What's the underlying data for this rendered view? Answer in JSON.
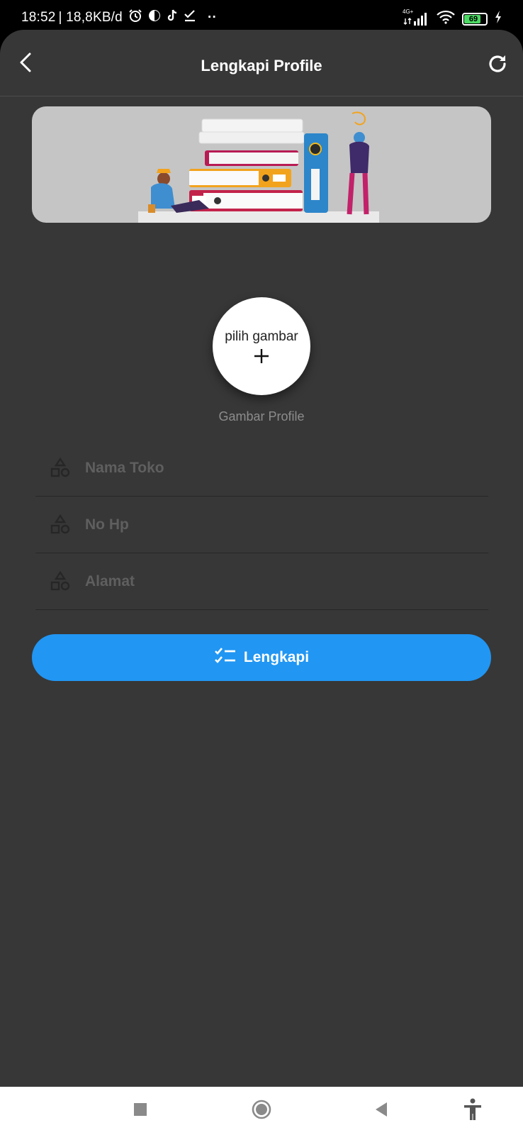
{
  "status_bar": {
    "time": "18:52",
    "net_speed": "| 18,8KB/d",
    "dots": "··",
    "signal_label": "4G+",
    "battery": "69"
  },
  "header": {
    "title": "Lengkapi Profile",
    "back_icon": "chevron-left-icon",
    "refresh_icon": "refresh-icon"
  },
  "banner": {
    "image": "people-with-stacked-books-illustration"
  },
  "avatar": {
    "button_label": "pilih gambar",
    "caption": "Gambar Profile"
  },
  "form": {
    "fields": [
      {
        "placeholder": "Nama Toko",
        "value": "",
        "icon": "shapes-icon"
      },
      {
        "placeholder": "No Hp",
        "value": "",
        "icon": "shapes-icon"
      },
      {
        "placeholder": "Alamat",
        "value": "",
        "icon": "shapes-icon"
      }
    ],
    "submit_label": "Lengkapi",
    "submit_icon": "checklist-icon"
  },
  "colors": {
    "background": "#373737",
    "primary": "#2196f3",
    "banner_bg": "#c5c5c5"
  },
  "nav_bar": {
    "buttons": [
      "square-icon",
      "home-circle-icon",
      "back-triangle-icon",
      "accessibility-icon"
    ]
  }
}
